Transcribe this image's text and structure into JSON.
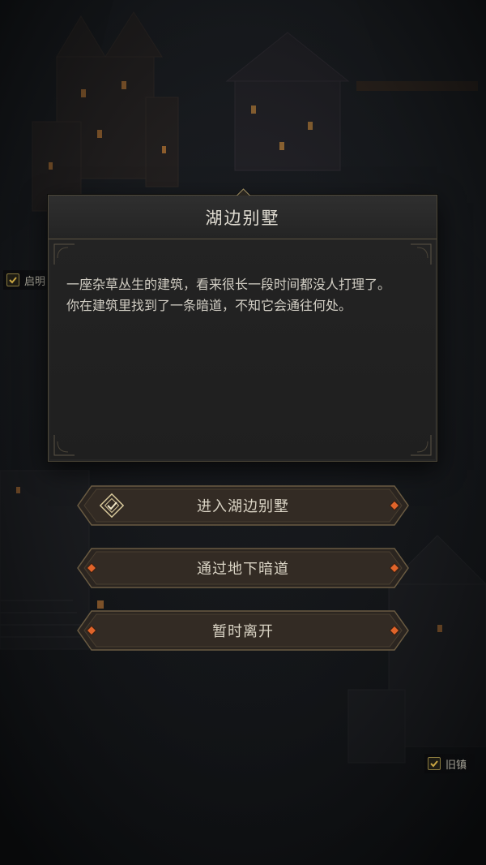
{
  "scene": {
    "location_labels": [
      {
        "name": "启明"
      },
      {
        "name": "旧镇"
      }
    ]
  },
  "dialog": {
    "title": "湖边别墅",
    "paragraphs": [
      "一座杂草丛生的建筑，看来很长一段时间都没人打理了。",
      "你在建筑里找到了一条暗道，不知它会通往何处。"
    ]
  },
  "options": [
    {
      "label": "进入湖边别墅",
      "selected": true
    },
    {
      "label": "通过地下暗道",
      "selected": false
    },
    {
      "label": "暂时离开",
      "selected": false
    }
  ],
  "colors": {
    "background": "#14161a",
    "panel": "#262626",
    "border_gold": "#5a523f",
    "accent_orange": "#e0642a",
    "text_light": "#d2cec4"
  }
}
